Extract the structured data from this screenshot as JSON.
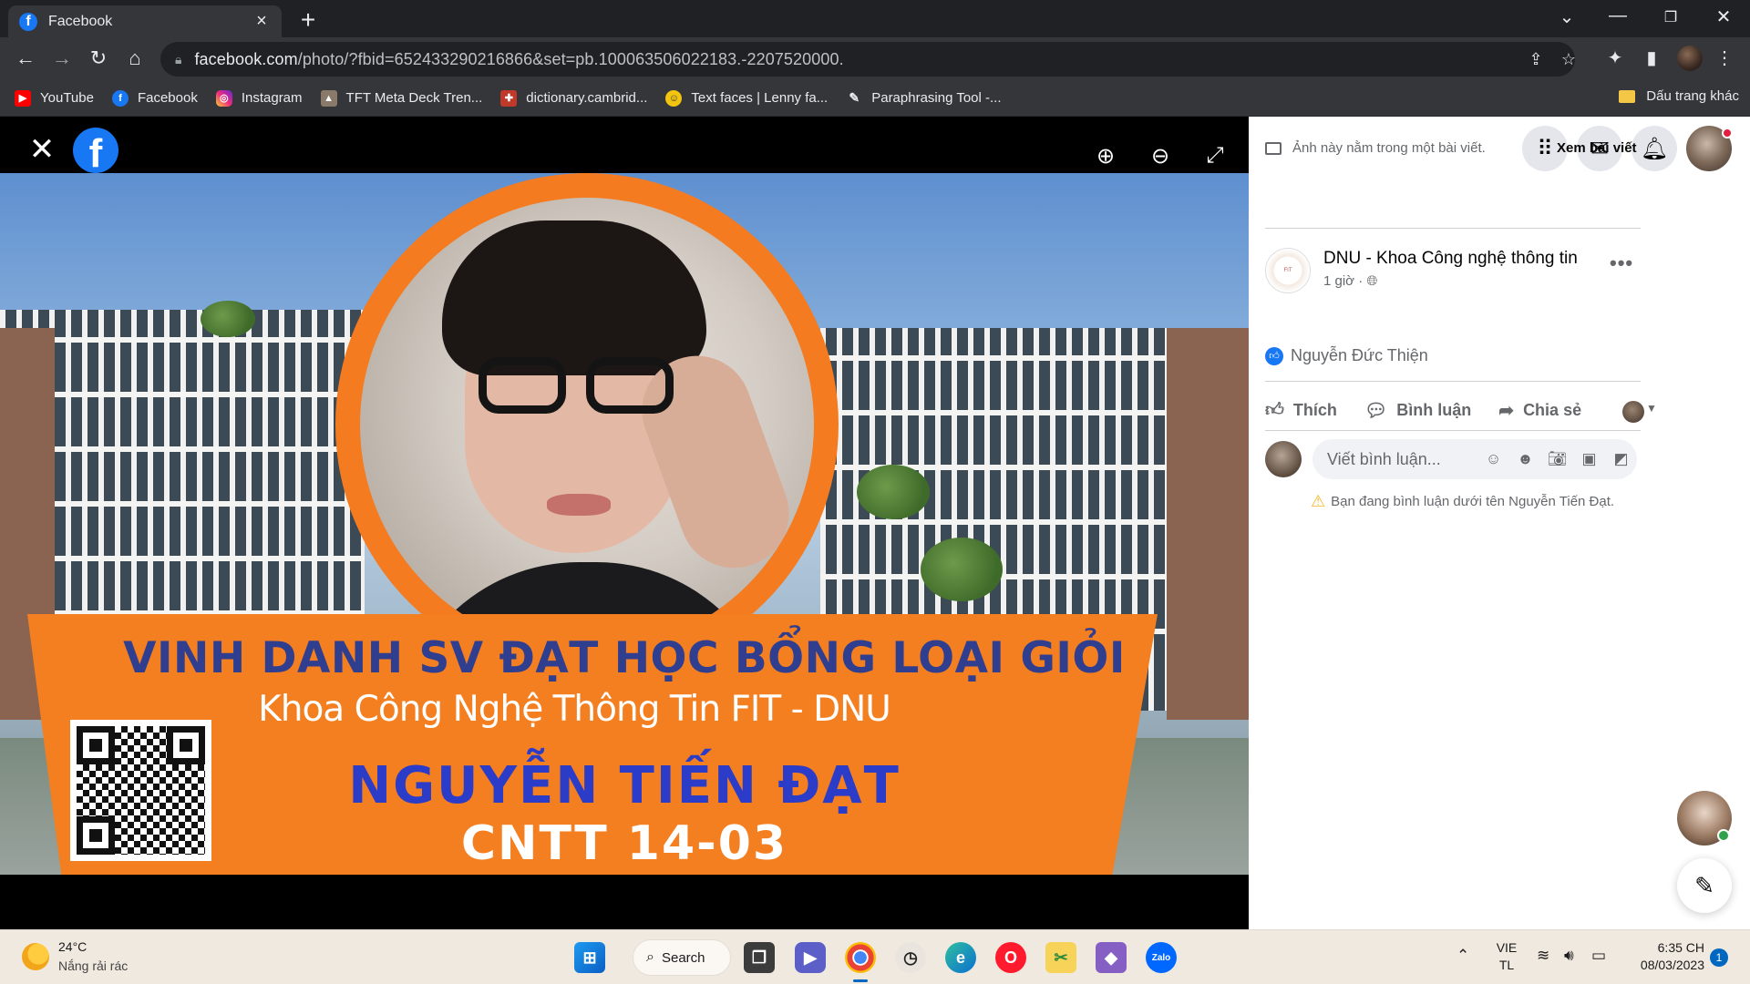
{
  "browser": {
    "tab_title": "Facebook",
    "url_host": "facebook.com",
    "url_rest": "/photo/?fbid=652433290216866&set=pb.100063506022183.-2207520000.",
    "bookmarks": [
      {
        "label": "YouTube",
        "icon": "youtube-icon",
        "color": "#ff0000"
      },
      {
        "label": "Facebook",
        "icon": "facebook-icon",
        "color": "#1877f2"
      },
      {
        "label": "Instagram",
        "icon": "instagram-icon",
        "color": "#d6249f"
      },
      {
        "label": "TFT Meta Deck Tren...",
        "icon": "tft-icon",
        "color": "#8a7a6a"
      },
      {
        "label": "dictionary.cambrid...",
        "icon": "cambridge-icon",
        "color": "#c0392b"
      },
      {
        "label": "Text faces | Lenny fa...",
        "icon": "lenny-face-icon",
        "color": "#f1c40f"
      },
      {
        "label": "Paraphrasing Tool -...",
        "icon": "quillbot-icon",
        "color": "#555555"
      }
    ],
    "other_bookmarks": "Dấu trang khác"
  },
  "photo": {
    "title": "VINH DANH SV ĐẠT HỌC BỔNG LOẠI GIỎI",
    "subtitle": "Khoa Công Nghệ Thông Tin FIT - DNU",
    "student_name": "NGUYỄN TIẾN ĐẠT",
    "student_class": "CNTT 14-03"
  },
  "panel": {
    "notice": "Ảnh này nằm trong một bài viết.",
    "see_post": "Xem bài viết",
    "page_name": "DNU - Khoa Công nghệ thông tin",
    "post_time": "1 giờ ·",
    "reactor": "Nguyễn Đức Thiện",
    "like_label": "Thích",
    "comment_label": "Bình luận",
    "share_label": "Chia sẻ",
    "comment_placeholder": "Viết bình luận...",
    "comment_warning": "Bạn đang bình luận dưới tên Nguyễn Tiến Đạt."
  },
  "taskbar": {
    "temperature": "24°C",
    "weather": "Nắng rải rác",
    "search_label": "Search",
    "lang_top": "VIE",
    "lang_bottom": "TL",
    "time": "6:35 CH",
    "date": "08/03/2023",
    "notifications": "1"
  },
  "colors": {
    "facebook_blue": "#1877f2",
    "banner_orange": "#f47f21",
    "title_navy": "#2f3e8f"
  }
}
